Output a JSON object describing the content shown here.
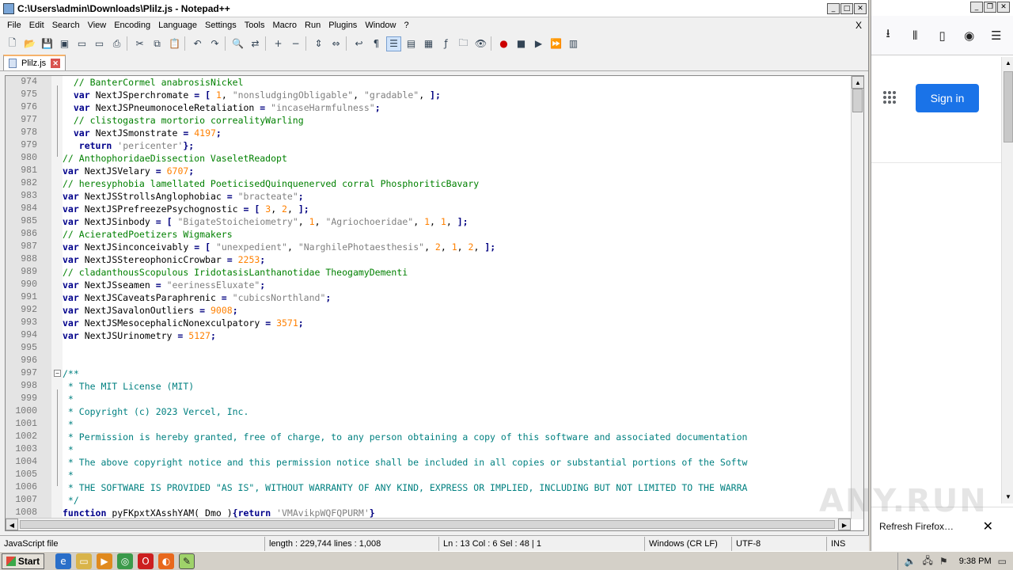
{
  "window": {
    "title": "C:\\Users\\admin\\Downloads\\Plilz.js - Notepad++",
    "close_doc_label": "X"
  },
  "menu": [
    "File",
    "Edit",
    "Search",
    "View",
    "Encoding",
    "Language",
    "Settings",
    "Tools",
    "Macro",
    "Run",
    "Plugins",
    "Window",
    "?"
  ],
  "toolbar_icons": [
    "new-file-icon",
    "open-file-icon",
    "save-icon",
    "save-all-icon",
    "close-icon",
    "close-all-icon",
    "print-icon",
    "cut-icon",
    "copy-icon",
    "paste-icon",
    "undo-icon",
    "redo-icon",
    "find-icon",
    "replace-icon",
    "zoom-in-icon",
    "zoom-out-icon",
    "sync-v-icon",
    "sync-h-icon",
    "word-wrap-icon",
    "show-all-chars-icon",
    "indent-guide-icon",
    "udl-icon",
    "doc-map-icon",
    "function-list-icon",
    "folder-workspace-icon",
    "monitor-icon",
    "record-macro-icon",
    "stop-macro-icon",
    "play-macro-icon",
    "run-macro-multiple-icon",
    "save-macro-icon"
  ],
  "tab": {
    "label": "Plilz.js"
  },
  "code": [
    {
      "n": "974",
      "segs": [
        [
          "id",
          "  "
        ],
        [
          "cm",
          "// BanterCormel anabrosisNickel"
        ]
      ]
    },
    {
      "n": "975",
      "segs": [
        [
          "id",
          "  "
        ],
        [
          "kw",
          "var"
        ],
        [
          "id",
          " NextJSperchromate "
        ],
        [
          "op",
          "="
        ],
        [
          "id",
          " "
        ],
        [
          "op",
          "["
        ],
        [
          "id",
          " "
        ],
        [
          "nm",
          "1"
        ],
        [
          "id",
          ", "
        ],
        [
          "st",
          "\"nonsludgingObligable\""
        ],
        [
          "id",
          ", "
        ],
        [
          "st",
          "\"gradable\""
        ],
        [
          "id",
          ", "
        ],
        [
          "op",
          "];"
        ]
      ]
    },
    {
      "n": "976",
      "segs": [
        [
          "id",
          "  "
        ],
        [
          "kw",
          "var"
        ],
        [
          "id",
          " NextJSPneumonoceleRetaliation "
        ],
        [
          "op",
          "="
        ],
        [
          "id",
          " "
        ],
        [
          "st",
          "\"incaseHarmfulness\""
        ],
        [
          "op",
          ";"
        ]
      ]
    },
    {
      "n": "977",
      "segs": [
        [
          "id",
          "  "
        ],
        [
          "cm",
          "// clistogastra mortorio correalityWarling"
        ]
      ]
    },
    {
      "n": "978",
      "segs": [
        [
          "id",
          "  "
        ],
        [
          "kw",
          "var"
        ],
        [
          "id",
          " NextJSmonstrate "
        ],
        [
          "op",
          "="
        ],
        [
          "id",
          " "
        ],
        [
          "nm",
          "4197"
        ],
        [
          "op",
          ";"
        ]
      ]
    },
    {
      "n": "979",
      "segs": [
        [
          "id",
          "   "
        ],
        [
          "kw",
          "return"
        ],
        [
          "id",
          " "
        ],
        [
          "st",
          "'pericenter'"
        ],
        [
          "op",
          "};"
        ]
      ]
    },
    {
      "n": "980",
      "segs": [
        [
          "cm",
          "// AnthophoridaeDissection VaseletReadopt"
        ]
      ]
    },
    {
      "n": "981",
      "segs": [
        [
          "kw",
          "var"
        ],
        [
          "id",
          " NextJSVelary "
        ],
        [
          "op",
          "="
        ],
        [
          "id",
          " "
        ],
        [
          "nm",
          "6707"
        ],
        [
          "op",
          ";"
        ]
      ]
    },
    {
      "n": "982",
      "segs": [
        [
          "cm",
          "// heresyphobia lamellated PoeticisedQuinquenerved corral PhosphoriticBavary"
        ]
      ]
    },
    {
      "n": "983",
      "segs": [
        [
          "kw",
          "var"
        ],
        [
          "id",
          " NextJSStrollsAnglophobiac "
        ],
        [
          "op",
          "="
        ],
        [
          "id",
          " "
        ],
        [
          "st",
          "\"bracteate\""
        ],
        [
          "op",
          ";"
        ]
      ]
    },
    {
      "n": "984",
      "segs": [
        [
          "kw",
          "var"
        ],
        [
          "id",
          " NextJSPrefreezePsychognostic "
        ],
        [
          "op",
          "="
        ],
        [
          "id",
          " "
        ],
        [
          "op",
          "["
        ],
        [
          "id",
          " "
        ],
        [
          "nm",
          "3"
        ],
        [
          "id",
          ", "
        ],
        [
          "nm",
          "2"
        ],
        [
          "id",
          ", "
        ],
        [
          "op",
          "];"
        ]
      ]
    },
    {
      "n": "985",
      "segs": [
        [
          "kw",
          "var"
        ],
        [
          "id",
          " NextJSinbody "
        ],
        [
          "op",
          "="
        ],
        [
          "id",
          " "
        ],
        [
          "op",
          "["
        ],
        [
          "id",
          " "
        ],
        [
          "st",
          "\"BigateStoicheiometry\""
        ],
        [
          "id",
          ", "
        ],
        [
          "nm",
          "1"
        ],
        [
          "id",
          ", "
        ],
        [
          "st",
          "\"Agriochoeridae\""
        ],
        [
          "id",
          ", "
        ],
        [
          "nm",
          "1"
        ],
        [
          "id",
          ", "
        ],
        [
          "nm",
          "1"
        ],
        [
          "id",
          ", "
        ],
        [
          "op",
          "];"
        ]
      ]
    },
    {
      "n": "986",
      "segs": [
        [
          "cm",
          "// AcieratedPoetizers Wigmakers"
        ]
      ]
    },
    {
      "n": "987",
      "segs": [
        [
          "kw",
          "var"
        ],
        [
          "id",
          " NextJSinconceivably "
        ],
        [
          "op",
          "="
        ],
        [
          "id",
          " "
        ],
        [
          "op",
          "["
        ],
        [
          "id",
          " "
        ],
        [
          "st",
          "\"unexpedient\""
        ],
        [
          "id",
          ", "
        ],
        [
          "st",
          "\"NarghilePhotaesthesis\""
        ],
        [
          "id",
          ", "
        ],
        [
          "nm",
          "2"
        ],
        [
          "id",
          ", "
        ],
        [
          "nm",
          "1"
        ],
        [
          "id",
          ", "
        ],
        [
          "nm",
          "2"
        ],
        [
          "id",
          ", "
        ],
        [
          "op",
          "];"
        ]
      ]
    },
    {
      "n": "988",
      "segs": [
        [
          "kw",
          "var"
        ],
        [
          "id",
          " NextJSStereophonicCrowbar "
        ],
        [
          "op",
          "="
        ],
        [
          "id",
          " "
        ],
        [
          "nm",
          "2253"
        ],
        [
          "op",
          ";"
        ]
      ]
    },
    {
      "n": "989",
      "segs": [
        [
          "cm",
          "// cladanthousScopulous IridotasisLanthanotidae TheogamyDementi"
        ]
      ]
    },
    {
      "n": "990",
      "segs": [
        [
          "kw",
          "var"
        ],
        [
          "id",
          " NextJSseamen "
        ],
        [
          "op",
          "="
        ],
        [
          "id",
          " "
        ],
        [
          "st",
          "\"eerinessEluxate\""
        ],
        [
          "op",
          ";"
        ]
      ]
    },
    {
      "n": "991",
      "segs": [
        [
          "kw",
          "var"
        ],
        [
          "id",
          " NextJSCaveatsParaphrenic "
        ],
        [
          "op",
          "="
        ],
        [
          "id",
          " "
        ],
        [
          "st",
          "\"cubicsNorthland\""
        ],
        [
          "op",
          ";"
        ]
      ]
    },
    {
      "n": "992",
      "segs": [
        [
          "kw",
          "var"
        ],
        [
          "id",
          " NextJSavalonOutliers "
        ],
        [
          "op",
          "="
        ],
        [
          "id",
          " "
        ],
        [
          "nm",
          "9008"
        ],
        [
          "op",
          ";"
        ]
      ]
    },
    {
      "n": "993",
      "segs": [
        [
          "kw",
          "var"
        ],
        [
          "id",
          " NextJSMesocephalicNonexculpatory "
        ],
        [
          "op",
          "="
        ],
        [
          "id",
          " "
        ],
        [
          "nm",
          "3571"
        ],
        [
          "op",
          ";"
        ]
      ]
    },
    {
      "n": "994",
      "segs": [
        [
          "kw",
          "var"
        ],
        [
          "id",
          " NextJSUrinometry "
        ],
        [
          "op",
          "="
        ],
        [
          "id",
          " "
        ],
        [
          "nm",
          "5127"
        ],
        [
          "op",
          ";"
        ]
      ]
    },
    {
      "n": "995",
      "segs": []
    },
    {
      "n": "996",
      "segs": []
    },
    {
      "n": "997",
      "segs": [
        [
          "dc",
          "/**"
        ]
      ]
    },
    {
      "n": "998",
      "segs": [
        [
          "dc",
          " * The MIT License (MIT)"
        ]
      ]
    },
    {
      "n": "999",
      "segs": [
        [
          "dc",
          " *"
        ]
      ]
    },
    {
      "n": "1000",
      "segs": [
        [
          "dc",
          " * Copyright (c) 2023 Vercel, Inc."
        ]
      ]
    },
    {
      "n": "1001",
      "segs": [
        [
          "dc",
          " *"
        ]
      ]
    },
    {
      "n": "1002",
      "segs": [
        [
          "dc",
          " * Permission is hereby granted, free of charge, to any person obtaining a copy of this software and associated documentation"
        ]
      ]
    },
    {
      "n": "1003",
      "segs": [
        [
          "dc",
          " *"
        ]
      ]
    },
    {
      "n": "1004",
      "segs": [
        [
          "dc",
          " * The above copyright notice and this permission notice shall be included in all copies or substantial portions of the Softw"
        ]
      ]
    },
    {
      "n": "1005",
      "segs": [
        [
          "dc",
          " *"
        ]
      ]
    },
    {
      "n": "1006",
      "segs": [
        [
          "dc",
          " * THE SOFTWARE IS PROVIDED \"AS IS\", WITHOUT WARRANTY OF ANY KIND, EXPRESS OR IMPLIED, INCLUDING BUT NOT LIMITED TO THE WARRA"
        ]
      ]
    },
    {
      "n": "1007",
      "segs": [
        [
          "dc",
          " */"
        ]
      ]
    },
    {
      "n": "1008",
      "segs": [
        [
          "kw",
          "function"
        ],
        [
          "id",
          " pyFKpxtXAsshYAM( Dmo )"
        ],
        [
          "op",
          "{"
        ],
        [
          "kw",
          "return"
        ],
        [
          "id",
          " "
        ],
        [
          "st",
          "'VMAvikpWQFQPURM'"
        ],
        [
          "op",
          "}"
        ]
      ]
    }
  ],
  "status": {
    "lang": "JavaScript file",
    "length": "length : 229,744    lines : 1,008",
    "pos": "Ln : 13    Col : 6    Sel : 48 | 1",
    "eol": "Windows (CR LF)",
    "enc": "UTF-8",
    "mode": "INS"
  },
  "firefox": {
    "sign_in": "Sign in",
    "notification": "Refresh Firefox…",
    "watermark": "ANY.RUN"
  },
  "taskbar": {
    "start": "Start",
    "clock": "9:38 PM"
  },
  "colors": {
    "keyword": "#00008b",
    "comment": "#008000",
    "doc_comment": "#008080",
    "string": "#808080",
    "number": "#ff8000",
    "signin_button": "#1a73e8"
  }
}
